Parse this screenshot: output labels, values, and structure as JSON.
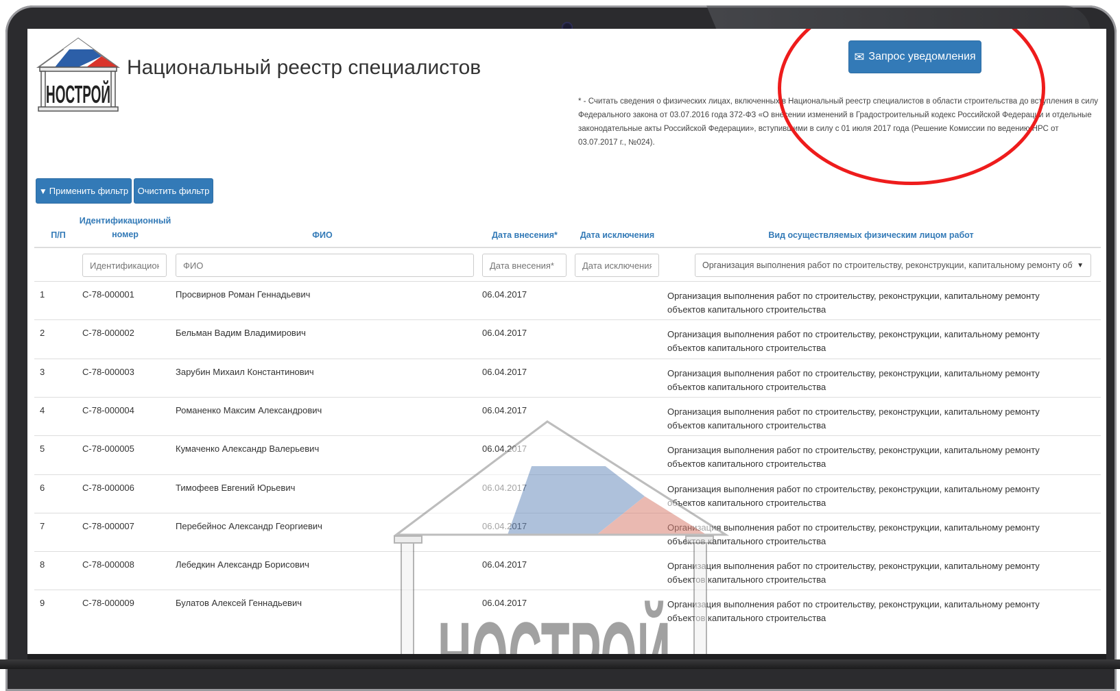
{
  "header": {
    "title": "Национальный реестр специалистов",
    "logo_text": "НОСТРОЙ",
    "notify_button": "Запрос уведомления",
    "footnote": "* - Считать сведения о физических лицах, включенных в Национальный реестр специалистов в области строительства до вступления в силу Федерального закона от 03.07.2016 года 372-ФЗ «О внесении изменений в Градостроительный кодекс Российской Федерации и отдельные законодательные акты Российской Федерации», вступившими в силу с 01 июля 2017 года (Решение Комиссии по ведению НРС от 03.07.2017 г., №024)."
  },
  "filters": {
    "apply_label": "Применить фильтр",
    "clear_label": "Очистить фильтр"
  },
  "table": {
    "headers": {
      "num": "П/П",
      "id_line1": "Идентификационный",
      "id_line2": "номер",
      "fio": "ФИО",
      "date_in": "Дата внесения*",
      "date_out": "Дата исключения",
      "work_type": "Вид осуществляемых физическим лицом работ"
    },
    "placeholders": {
      "id": "Идентификационный номер",
      "fio": "ФИО",
      "date_in": "Дата внесения*",
      "date_out": "Дата исключения"
    },
    "work_type_selected": "Организация выполнения работ по строительству, реконструкции, капитальному ремонту объектов капитального строительства",
    "rows": [
      {
        "n": "1",
        "id": "С-78-000001",
        "fio": "Просвирнов Роман Геннадьевич",
        "date_in": "06.04.2017",
        "work": "Организация выполнения работ по строительству, реконструкции, капитальному ремонту объектов капитального строительства"
      },
      {
        "n": "2",
        "id": "С-78-000002",
        "fio": "Бельман Вадим Владимирович",
        "date_in": "06.04.2017",
        "work": "Организация выполнения работ по строительству, реконструкции, капитальному ремонту объектов капитального строительства"
      },
      {
        "n": "3",
        "id": "С-78-000003",
        "fio": "Зарубин Михаил Константинович",
        "date_in": "06.04.2017",
        "work": "Организация выполнения работ по строительству, реконструкции, капитальному ремонту объектов капитального строительства"
      },
      {
        "n": "4",
        "id": "С-78-000004",
        "fio": "Романенко Максим Александрович",
        "date_in": "06.04.2017",
        "work": "Организация выполнения работ по строительству, реконструкции, капитальному ремонту объектов капитального строительства"
      },
      {
        "n": "5",
        "id": "С-78-000005",
        "fio": "Кумаченко Александр Валерьевич",
        "date_in": "06.04.2017",
        "work": "Организация выполнения работ по строительству, реконструкции, капитальному ремонту объектов капитального строительства"
      },
      {
        "n": "6",
        "id": "С-78-000006",
        "fio": "Тимофеев Евгений Юрьевич",
        "date_in": "06.04.2017",
        "work": "Организация выполнения работ по строительству, реконструкции, капитальному ремонту объектов капитального строительства"
      },
      {
        "n": "7",
        "id": "С-78-000007",
        "fio": "Перебейнос Александр Георгиевич",
        "date_in": "06.04.2017",
        "work": "Организация выполнения работ по строительству, реконструкции, капитальному ремонту объектов капитального строительства"
      },
      {
        "n": "8",
        "id": "С-78-000008",
        "fio": "Лебедкин Александр Борисович",
        "date_in": "06.04.2017",
        "work": "Организация выполнения работ по строительству, реконструкции, капитальному ремонту объектов капитального строительства"
      },
      {
        "n": "9",
        "id": "С-78-000009",
        "fio": "Булатов Алексей Геннадьевич",
        "date_in": "06.04.2017",
        "work": "Организация выполнения работ по строительству, реконструкции, капитальному ремонту объектов капитального строительства"
      }
    ]
  },
  "colors": {
    "primary": "#337ab7",
    "highlight": "#ee1c1c",
    "logo_blue": "#2c5fa8",
    "logo_red": "#d9342b"
  }
}
